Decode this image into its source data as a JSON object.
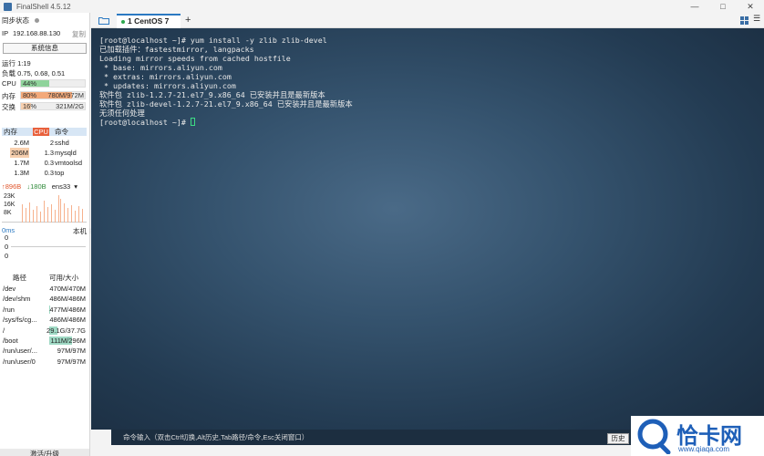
{
  "window": {
    "title": "FinalShell 4.5.12"
  },
  "sidebar": {
    "sync_label": "同步状态",
    "ip_label": "IP",
    "ip_value": "192.168.88.130",
    "copy_label": "复制",
    "sysinfo_button": "系统信息",
    "uptime": "运行 1:19",
    "load": "负载 0.75, 0.68, 0.51",
    "cpu_label": "CPU",
    "cpu_value": "44%",
    "cpu_fraction": 0.44,
    "mem_label": "内存",
    "mem_percent": "80%",
    "mem_fraction": 0.8,
    "mem_value": "780M/972M",
    "swap_label": "交换",
    "swap_percent": "16%",
    "swap_fraction": 0.16,
    "swap_value": "321M/2G",
    "proc_headers": [
      "内存",
      "CPU",
      "命令"
    ],
    "processes": [
      {
        "mem": "2.6M",
        "cpu": "2",
        "cmd": "sshd"
      },
      {
        "mem": "206M",
        "cpu": "1.3",
        "cmd": "mysqld"
      },
      {
        "mem": "1.7M",
        "cpu": "0.3",
        "cmd": "vmtoolsd"
      },
      {
        "mem": "1.3M",
        "cpu": "0.3",
        "cmd": "top"
      }
    ],
    "net_up": "↑896B",
    "net_down": "↓180B",
    "net_iface": "ens33",
    "net_scale": [
      "23K",
      "16K",
      "8K"
    ],
    "ping_label": "0ms",
    "ping_local": "本机",
    "ping_scale": [
      "0",
      "0",
      "0"
    ],
    "fs_headers": [
      "路径",
      "可用/大小"
    ],
    "filesystems": [
      {
        "path": "/dev",
        "size": "470M/470M",
        "used": 0.0
      },
      {
        "path": "/dev/shm",
        "size": "486M/486M",
        "used": 0.0
      },
      {
        "path": "/run",
        "size": "477M/486M",
        "used": 0.02
      },
      {
        "path": "/sys/fs/cg...",
        "size": "486M/486M",
        "used": 0.0
      },
      {
        "path": "/",
        "size": "29.1G/37.7G",
        "used": 0.23
      },
      {
        "path": "/boot",
        "size": "111M/296M",
        "used": 0.62
      },
      {
        "path": "/run/user/...",
        "size": "97M/97M",
        "used": 0.0
      },
      {
        "path": "/run/user/0",
        "size": "97M/97M",
        "used": 0.0
      }
    ],
    "upgrade_label": "激活/升级"
  },
  "tabs": {
    "active_label": "1 CentOS 7",
    "add_label": "+"
  },
  "terminal": {
    "lines": [
      "[root@localhost ~]# yum install -y zlib zlib-devel",
      "已加载插件：fastestmirror, langpacks",
      "Loading mirror speeds from cached hostfile",
      " * base: mirrors.aliyun.com",
      " * extras: mirrors.aliyun.com",
      " * updates: mirrors.aliyun.com",
      "软件包 zlib-1.2.7-21.el7_9.x86_64 已安装并且是最新版本",
      "软件包 zlib-devel-1.2.7-21.el7_9.x86_64 已安装并且是最新版本",
      "无须任何处理",
      "[root@localhost ~]# "
    ]
  },
  "cmdbar": {
    "placeholder": "命令输入（双击Ctrl切换,Alt历史,Tab路径/命令,Esc关闭窗口）",
    "history_button": "历史"
  },
  "watermark": {
    "text": "恰卡网",
    "sub": "www.qiaqa.com"
  },
  "colors": {
    "accent": "#2b79c2",
    "cpu_bar": "#8fd39b",
    "mem_bar": "#f3a97a",
    "swap_bar": "#f7cfae",
    "disk_bar": "#9fd9c4",
    "watermark": "#1e5fb8"
  }
}
